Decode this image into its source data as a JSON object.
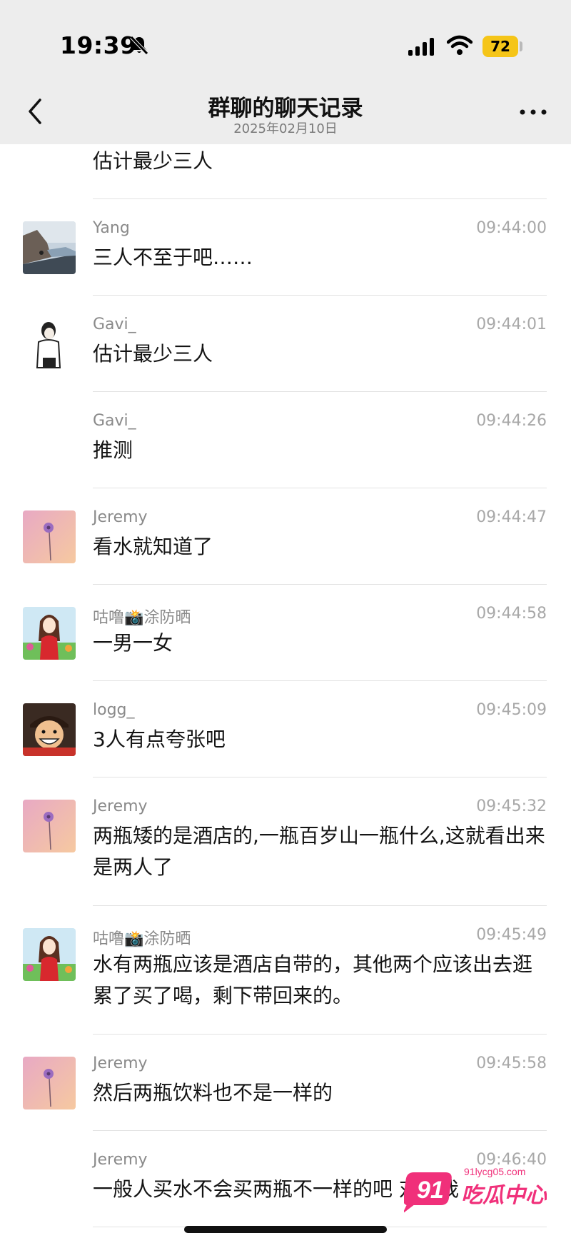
{
  "status_bar": {
    "time": "19:39",
    "battery": "72"
  },
  "nav": {
    "title": "群聊的聊天记录",
    "subtitle": "2025年02月10日"
  },
  "messages": [
    {
      "sender": "",
      "time": "",
      "text": "估计最少三人",
      "avatar": "none"
    },
    {
      "sender": "Yang",
      "time": "09:44:00",
      "text": "三人不至于吧……",
      "avatar": "coast-photo"
    },
    {
      "sender": "Gavi_",
      "time": "09:44:01",
      "text": "估计最少三人",
      "avatar": "sketch-person"
    },
    {
      "sender": "Gavi_",
      "time": "09:44:26",
      "text": "推测",
      "avatar": "none"
    },
    {
      "sender": "Jeremy",
      "time": "09:44:47",
      "text": "看水就知道了",
      "avatar": "flower-gradient"
    },
    {
      "sender": "咕噜📸涂防晒",
      "time": "09:44:58",
      "text": "一男一女",
      "avatar": "cartoon-girl"
    },
    {
      "sender": "logg_",
      "time": "09:45:09",
      "text": "3人有点夸张吧",
      "avatar": "anime-character"
    },
    {
      "sender": "Jeremy",
      "time": "09:45:32",
      "text": "两瓶矮的是酒店的,一瓶百岁山一瓶什么,这就看出来是两人了",
      "avatar": "flower-gradient"
    },
    {
      "sender": "咕噜📸涂防晒",
      "time": "09:45:49",
      "text": "水有两瓶应该是酒店自带的，其他两个应该出去逛累了买了喝，剩下带回来的。",
      "avatar": "cartoon-girl"
    },
    {
      "sender": "Jeremy",
      "time": "09:45:58",
      "text": "然后两瓶饮料也不是一样的",
      "avatar": "flower-gradient"
    },
    {
      "sender": "Jeremy",
      "time": "09:46:40",
      "text": "一般人买水不会买两瓶不一样的吧 对了我",
      "avatar": "none"
    }
  ],
  "watermark": {
    "number": "91",
    "url": "91lycg05.com",
    "brand": "吃瓜中心"
  },
  "colors": {
    "bar_bg": "#ededed",
    "battery": "#f5c518",
    "watermark": "#f0307a"
  }
}
